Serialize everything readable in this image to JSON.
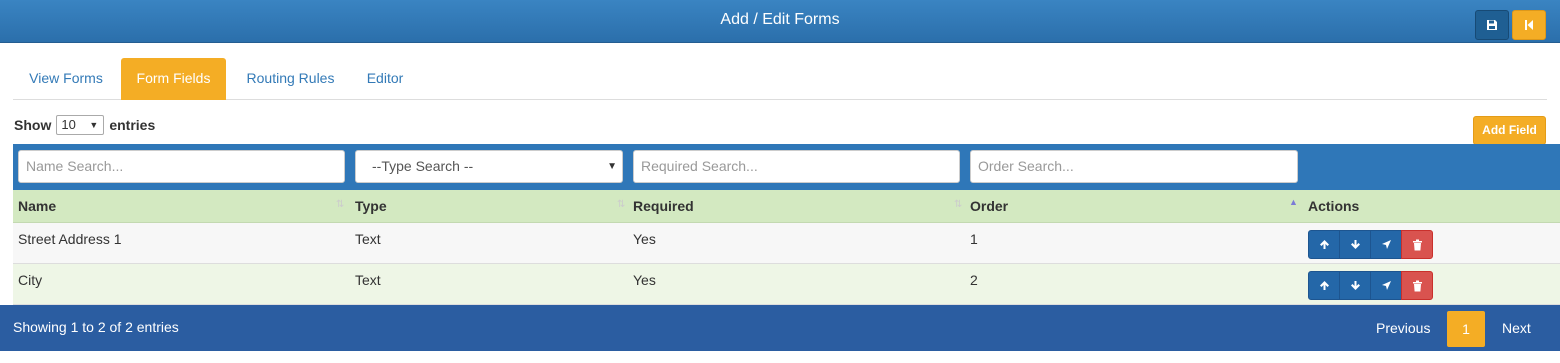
{
  "header": {
    "title": "Add / Edit Forms",
    "save_icon": "floppy-disk-icon",
    "back_icon": "step-backward-icon",
    "colors": {
      "primary": "#2f77b8",
      "accent": "#f4ad25",
      "danger": "#d9534f"
    }
  },
  "tabs": [
    {
      "label": "View Forms",
      "active": false
    },
    {
      "label": "Form Fields",
      "active": true
    },
    {
      "label": "Routing Rules",
      "active": false
    },
    {
      "label": "Editor",
      "active": false
    }
  ],
  "length_control": {
    "show": "Show",
    "value": "10",
    "entries": "entries"
  },
  "add_field_label": "Add Field",
  "filters": {
    "name_placeholder": "Name Search...",
    "type_value": "--Type Search --",
    "required_placeholder": "Required Search...",
    "order_placeholder": "Order Search..."
  },
  "table": {
    "columns": [
      "Name",
      "Type",
      "Required",
      "Order",
      "Actions"
    ],
    "rows": [
      {
        "name": "Street Address 1",
        "type": "Text",
        "required": "Yes",
        "order": "1"
      },
      {
        "name": "City",
        "type": "Text",
        "required": "Yes",
        "order": "2"
      }
    ],
    "action_icons": [
      "arrow-up-icon",
      "arrow-down-icon",
      "location-arrow-icon",
      "trash-icon"
    ]
  },
  "footer": {
    "info": "Showing 1 to 2 of 2 entries",
    "previous": "Previous",
    "current_page": "1",
    "next": "Next"
  }
}
